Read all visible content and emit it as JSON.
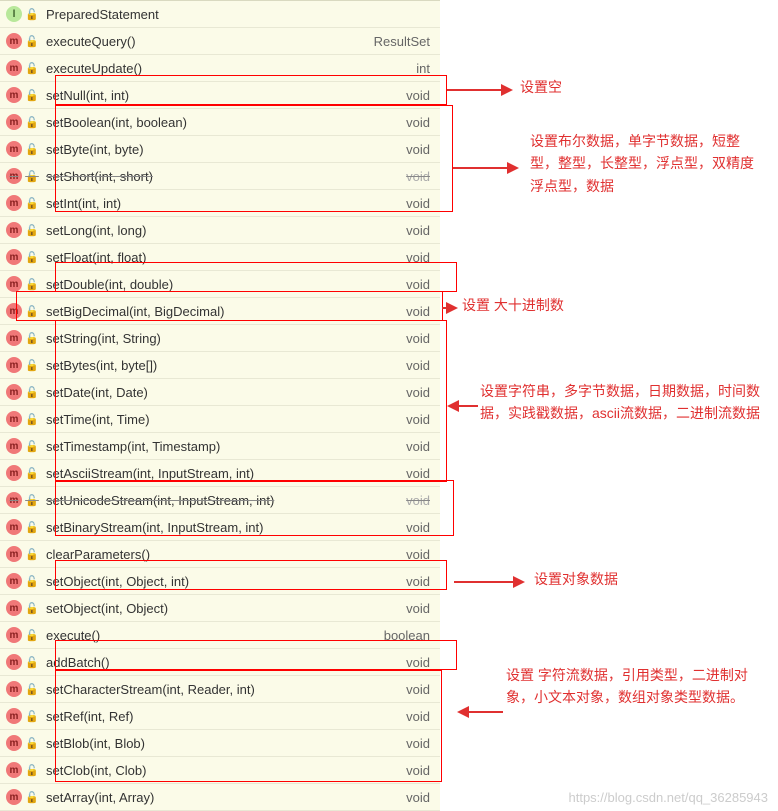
{
  "header": {
    "icon": "I",
    "name": "PreparedStatement"
  },
  "methods": [
    {
      "name": "executeQuery()",
      "ret": "ResultSet",
      "strike": false
    },
    {
      "name": "executeUpdate()",
      "ret": "int",
      "strike": false
    },
    {
      "name": "setNull(int, int)",
      "ret": "void",
      "strike": false
    },
    {
      "name": "setBoolean(int, boolean)",
      "ret": "void",
      "strike": false
    },
    {
      "name": "setByte(int, byte)",
      "ret": "void",
      "strike": false
    },
    {
      "name": "setShort(int, short)",
      "ret": "void",
      "strike": true
    },
    {
      "name": "setInt(int, int)",
      "ret": "void",
      "strike": false
    },
    {
      "name": "setLong(int, long)",
      "ret": "void",
      "strike": false
    },
    {
      "name": "setFloat(int, float)",
      "ret": "void",
      "strike": false
    },
    {
      "name": "setDouble(int, double)",
      "ret": "void",
      "strike": false
    },
    {
      "name": "setBigDecimal(int, BigDecimal)",
      "ret": "void",
      "strike": false
    },
    {
      "name": "setString(int, String)",
      "ret": "void",
      "strike": false
    },
    {
      "name": "setBytes(int, byte[])",
      "ret": "void",
      "strike": false
    },
    {
      "name": "setDate(int, Date)",
      "ret": "void",
      "strike": false
    },
    {
      "name": "setTime(int, Time)",
      "ret": "void",
      "strike": false
    },
    {
      "name": "setTimestamp(int, Timestamp)",
      "ret": "void",
      "strike": false
    },
    {
      "name": "setAsciiStream(int, InputStream, int)",
      "ret": "void",
      "strike": false
    },
    {
      "name": "setUnicodeStream(int, InputStream, int)",
      "ret": "void",
      "strike": true
    },
    {
      "name": "setBinaryStream(int, InputStream, int)",
      "ret": "void",
      "strike": false
    },
    {
      "name": "clearParameters()",
      "ret": "void",
      "strike": false
    },
    {
      "name": "setObject(int, Object, int)",
      "ret": "void",
      "strike": false
    },
    {
      "name": "setObject(int, Object)",
      "ret": "void",
      "strike": false
    },
    {
      "name": "execute()",
      "ret": "boolean",
      "strike": false
    },
    {
      "name": "addBatch()",
      "ret": "void",
      "strike": false
    },
    {
      "name": "setCharacterStream(int, Reader, int)",
      "ret": "void",
      "strike": false
    },
    {
      "name": "setRef(int, Ref)",
      "ret": "void",
      "strike": false
    },
    {
      "name": "setBlob(int, Blob)",
      "ret": "void",
      "strike": false
    },
    {
      "name": "setClob(int, Clob)",
      "ret": "void",
      "strike": false
    },
    {
      "name": "setArray(int, Array)",
      "ret": "void",
      "strike": false
    }
  ],
  "annos": {
    "a1": "设置空",
    "a2": "设置布尔数据，单字节数据，短整型，整型，长整型，浮点型，双精度浮点型，数据",
    "a3": "设置  大十进制数",
    "a4": "设置字符串，多字节数据，日期数据，时间数据，实践戳数据，ascii流数据，二进制流数据",
    "a5": "设置对象数据",
    "a6": "设置 字符流数据，引用类型，二进制对象，小文本对象，数组对象类型数据。"
  },
  "watermark": "https://blog.csdn.net/qq_36285943"
}
